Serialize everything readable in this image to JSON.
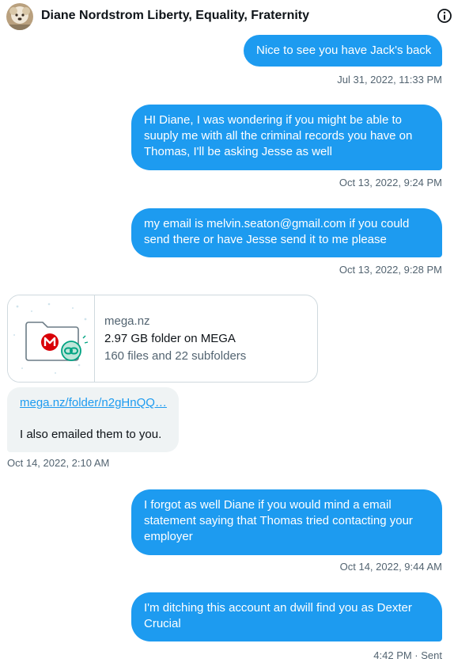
{
  "header": {
    "title": "Diane Nordstrom Liberty, Equality, Fraternity",
    "info_icon": "info-circle-icon"
  },
  "messages": [
    {
      "text": "Nice to see you have Jack's back",
      "timestamp": "Jul 31, 2022, 11:33 PM"
    },
    {
      "text": "HI Diane, I was wondering if you might be able to suuply me with all the criminal records you have on Thomas, I'll be asking Jesse as well",
      "timestamp": "Oct 13, 2022, 9:24 PM"
    },
    {
      "text": "my email is melvin.seaton@gmail.com if you could send there or have Jesse send it to me please",
      "timestamp": "Oct 13, 2022, 9:28 PM"
    }
  ],
  "card": {
    "domain": "mega.nz",
    "title": "2.97 GB folder on MEGA",
    "description": "160 files and 22 subfolders",
    "thumb_icon": "mega-folder-link-icon"
  },
  "incoming": {
    "link": "mega.nz/folder/n2gHnQQ…",
    "text": "I also emailed them to you.",
    "timestamp": "Oct 14, 2022, 2:10 AM"
  },
  "later": [
    {
      "text": "I forgot as well Diane if you would mind a email statement saying that Thomas tried contacting your employer",
      "timestamp": "Oct 14, 2022, 9:44 AM"
    },
    {
      "text": "I'm ditching this account an dwill find you as Dexter Crucial",
      "timestamp": "4:42 PM · Sent"
    }
  ],
  "colors": {
    "accent": "#1d9bf0",
    "incoming_bg": "#eff3f4",
    "muted_text": "#536471",
    "mega_red": "#d90007",
    "link_badge": "#00a382"
  }
}
